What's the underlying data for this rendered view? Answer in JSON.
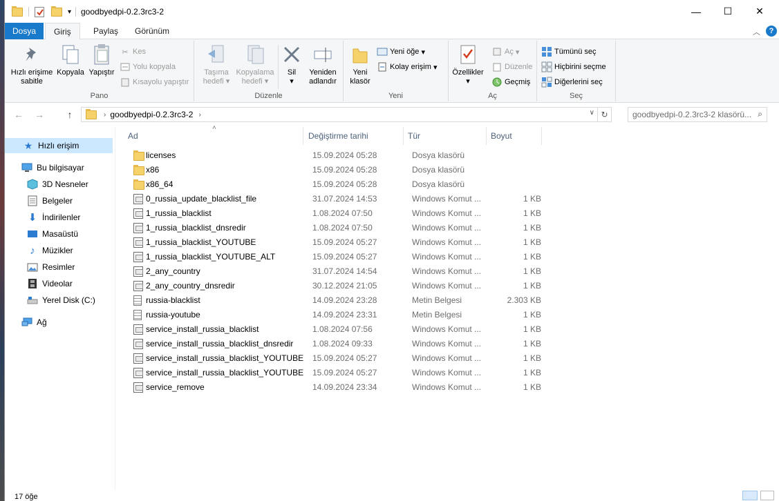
{
  "window": {
    "title": "goodbyedpi-0.2.3rc3-2",
    "minimize": "—",
    "maximize": "☐",
    "close": "✕"
  },
  "ribbon_tabs": [
    "Dosya",
    "Giriş",
    "Paylaş",
    "Görünüm"
  ],
  "ribbon": {
    "pano": {
      "label": "Pano",
      "pin": [
        "Hızlı erişime",
        "sabitle"
      ],
      "copy": "Kopyala",
      "paste": "Yapıştır",
      "cut": "Kes",
      "copy_path": "Yolu kopyala",
      "paste_shortcut": "Kısayolu yapıştır"
    },
    "duzenle": {
      "label": "Düzenle",
      "move_to": [
        "Taşıma",
        "hedefi"
      ],
      "copy_to": [
        "Kopyalama",
        "hedefi"
      ],
      "delete": "Sil",
      "rename": [
        "Yeniden",
        "adlandır"
      ]
    },
    "yeni": {
      "label": "Yeni",
      "new_folder": [
        "Yeni",
        "klasör"
      ],
      "new_item": "Yeni öğe",
      "easy_access": "Kolay erişim"
    },
    "ac": {
      "label": "Aç",
      "properties": "Özellikler",
      "open": "Aç",
      "edit": "Düzenle",
      "history": "Geçmiş"
    },
    "sec": {
      "label": "Seç",
      "select_all": "Tümünü seç",
      "select_none": "Hiçbirini seçme",
      "invert": "Diğerlerini seç"
    }
  },
  "address": {
    "path": "goodbyedpi-0.2.3rc3-2",
    "search_placeholder": "goodbyedpi-0.2.3rc3-2 klasörü..."
  },
  "nav": {
    "quick_access": "Hızlı erişim",
    "this_pc": "Bu bilgisayar",
    "items": [
      "3D Nesneler",
      "Belgeler",
      "İndirilenler",
      "Masaüstü",
      "Müzikler",
      "Resimler",
      "Videolar",
      "Yerel Disk (C:)"
    ],
    "network": "Ağ"
  },
  "columns": [
    "Ad",
    "Değiştirme tarihi",
    "Tür",
    "Boyut"
  ],
  "files": [
    {
      "name": "licenses",
      "date": "15.09.2024 05:28",
      "type": "Dosya klasörü",
      "size": "",
      "icon": "folder"
    },
    {
      "name": "x86",
      "date": "15.09.2024 05:28",
      "type": "Dosya klasörü",
      "size": "",
      "icon": "folder"
    },
    {
      "name": "x86_64",
      "date": "15.09.2024 05:28",
      "type": "Dosya klasörü",
      "size": "",
      "icon": "folder"
    },
    {
      "name": "0_russia_update_blacklist_file",
      "date": "31.07.2024 14:53",
      "type": "Windows Komut ...",
      "size": "1 KB",
      "icon": "bat"
    },
    {
      "name": "1_russia_blacklist",
      "date": "1.08.2024 07:50",
      "type": "Windows Komut ...",
      "size": "1 KB",
      "icon": "bat"
    },
    {
      "name": "1_russia_blacklist_dnsredir",
      "date": "1.08.2024 07:50",
      "type": "Windows Komut ...",
      "size": "1 KB",
      "icon": "bat"
    },
    {
      "name": "1_russia_blacklist_YOUTUBE",
      "date": "15.09.2024 05:27",
      "type": "Windows Komut ...",
      "size": "1 KB",
      "icon": "bat"
    },
    {
      "name": "1_russia_blacklist_YOUTUBE_ALT",
      "date": "15.09.2024 05:27",
      "type": "Windows Komut ...",
      "size": "1 KB",
      "icon": "bat"
    },
    {
      "name": "2_any_country",
      "date": "31.07.2024 14:54",
      "type": "Windows Komut ...",
      "size": "1 KB",
      "icon": "bat"
    },
    {
      "name": "2_any_country_dnsredir",
      "date": "30.12.2024 21:05",
      "type": "Windows Komut ...",
      "size": "1 KB",
      "icon": "bat"
    },
    {
      "name": "russia-blacklist",
      "date": "14.09.2024 23:28",
      "type": "Metin Belgesi",
      "size": "2.303 KB",
      "icon": "txt"
    },
    {
      "name": "russia-youtube",
      "date": "14.09.2024 23:31",
      "type": "Metin Belgesi",
      "size": "1 KB",
      "icon": "txt"
    },
    {
      "name": "service_install_russia_blacklist",
      "date": "1.08.2024 07:56",
      "type": "Windows Komut ...",
      "size": "1 KB",
      "icon": "bat"
    },
    {
      "name": "service_install_russia_blacklist_dnsredir",
      "date": "1.08.2024 09:33",
      "type": "Windows Komut ...",
      "size": "1 KB",
      "icon": "bat"
    },
    {
      "name": "service_install_russia_blacklist_YOUTUBE",
      "date": "15.09.2024 05:27",
      "type": "Windows Komut ...",
      "size": "1 KB",
      "icon": "bat"
    },
    {
      "name": "service_install_russia_blacklist_YOUTUBE_...",
      "date": "15.09.2024 05:27",
      "type": "Windows Komut ...",
      "size": "1 KB",
      "icon": "bat"
    },
    {
      "name": "service_remove",
      "date": "14.09.2024 23:34",
      "type": "Windows Komut ...",
      "size": "1 KB",
      "icon": "bat"
    }
  ],
  "status": {
    "item_count": "17 öğe"
  }
}
